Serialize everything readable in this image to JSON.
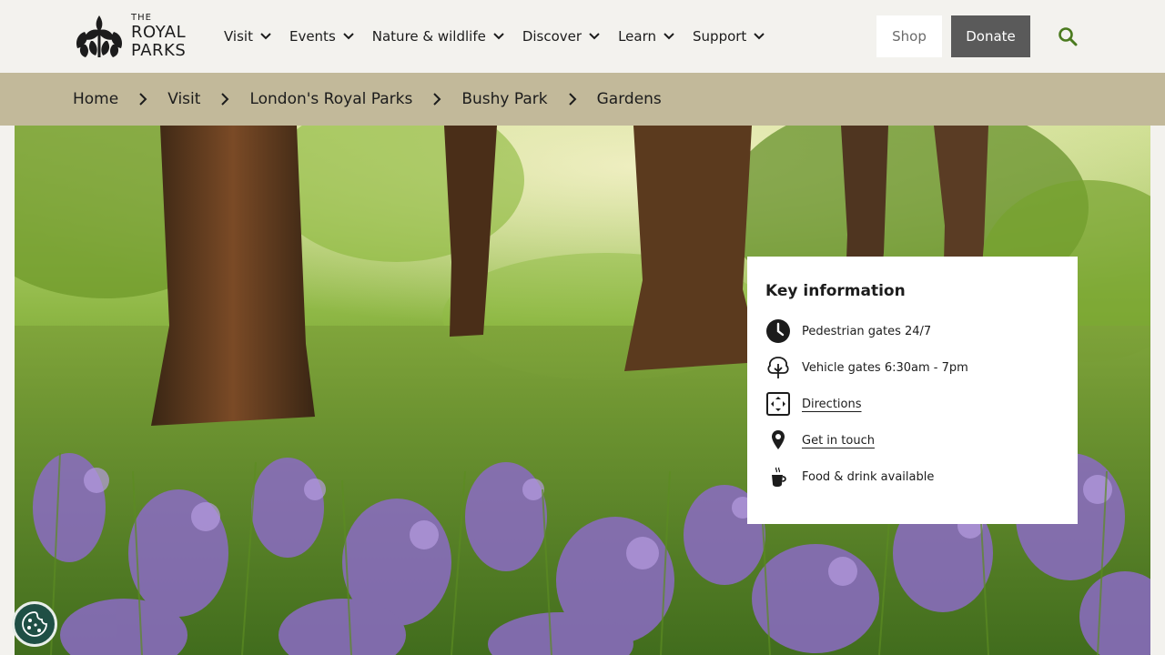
{
  "brand": {
    "the": "THE",
    "royal": "ROYAL",
    "parks": "PARKS"
  },
  "nav": {
    "items": [
      {
        "label": "Visit"
      },
      {
        "label": "Events"
      },
      {
        "label": "Nature & wildlife"
      },
      {
        "label": "Discover"
      },
      {
        "label": "Learn"
      },
      {
        "label": "Support"
      }
    ]
  },
  "header": {
    "shop_label": "Shop",
    "donate_label": "Donate"
  },
  "breadcrumb": [
    "Home",
    "Visit",
    "London's Royal Parks",
    "Bushy Park",
    "Gardens"
  ],
  "key_info": {
    "title": "Key information",
    "items": [
      {
        "icon": "clock-icon",
        "text": "Pedestrian gates 24/7",
        "link": false
      },
      {
        "icon": "tree-icon",
        "text": "Vehicle gates 6:30am - 7pm",
        "link": false
      },
      {
        "icon": "directions-icon",
        "text": "Directions",
        "link": true
      },
      {
        "icon": "location-pin-icon",
        "text": "Get in touch",
        "link": true
      },
      {
        "icon": "coffee-cup-icon",
        "text": "Food & drink available",
        "link": false
      }
    ]
  },
  "colors": {
    "header_bg": "#f3f2ee",
    "breadcrumb_bg": "#c2b99a",
    "donate_bg": "#5a5a5a",
    "search_icon": "#4a7a1e",
    "cookie_bg": "#1f4f45"
  }
}
